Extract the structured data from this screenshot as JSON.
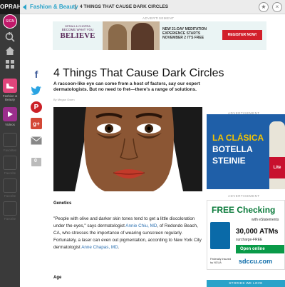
{
  "app": {
    "brand": "OPRAH",
    "signin_label": "SIGN IN"
  },
  "sidebar": {
    "items": [
      {
        "label": "Fashion & Beauty",
        "icon": "shoe-icon",
        "active": true,
        "color": "#e0457b"
      },
      {
        "label": "Videos",
        "icon": "play-icon",
        "active": false,
        "color": "#9b2e8c"
      },
      {
        "label": "Favorites",
        "icon": "blank-icon",
        "active": false
      },
      {
        "label": "Favorite",
        "icon": "blank-icon",
        "active": false
      },
      {
        "label": "Favorite",
        "icon": "blank-icon",
        "active": false
      },
      {
        "label": "Favorite",
        "icon": "blank-icon",
        "active": false
      }
    ]
  },
  "topbar": {
    "section": "Fashion & Beauty",
    "separator": "|",
    "title": "4 THINGS THAT CAUSE DARK CIRCLES",
    "star_icon": "★",
    "close_icon": "×"
  },
  "top_ad": {
    "label": "ADVERTISEMENT",
    "brand": "OPRAH & CHOPRA",
    "tagline_small": "BECOME WHAT YOU",
    "tagline_big": "BELIEVE",
    "text": "NEW 21-DAY MEDITATION EXPERIENCE STARTS NOVEMBER 2 IT'S FREE",
    "button": "REGISTER NOW!"
  },
  "share": {
    "facebook": "f",
    "twitter": "t",
    "pinterest": "P",
    "googleplus": "g+",
    "email": "✉",
    "comments": "0"
  },
  "article": {
    "title": "4 Things That Cause Dark Circles",
    "dek": "A raccoon-like eye can come from a host of factors, say our expert dermatologists. But no need to fret—there's a range of solutions.",
    "byline": "By Megan Gwen",
    "section1": "Genetics",
    "quote_part1": "\"People with olive and darker skin tones tend to get a little discoloration under the eyes,\" says dermatologist ",
    "quote_link1": "Annie Chiu, MD",
    "quote_part2": ", of Redondo Beach, CA, who stresses the importance of wearing sunscreen regularly. Fortunately, a laser can even out pigmentation, according to New York City dermatologist ",
    "quote_link2": "Anne Chapas, MD",
    "quote_part3": ".",
    "section2": "Age"
  },
  "right_ads": {
    "label1": "ADVERTISEMENT",
    "beer_l1": "LA CLÁSICA",
    "beer_l2": "BOTELLA",
    "beer_l3": "STEINIE",
    "beer_brand": "Lite",
    "label2": "ADVERTISEMENT",
    "bank_free": "FREE Checking",
    "bank_sub": "with eStatements",
    "bank_atm": "30,000 ATMs",
    "bank_surcharge": "surcharge-FREE",
    "bank_open": "Open online",
    "bank_ncua": "Federally insured by NCUA",
    "bank_logo": "sdccu.com",
    "stories": "STORIES WE LOVE"
  },
  "colors": {
    "accent": "#29a3c9",
    "sidebar_bg": "#3a3a3a",
    "link": "#2a6fb0"
  }
}
